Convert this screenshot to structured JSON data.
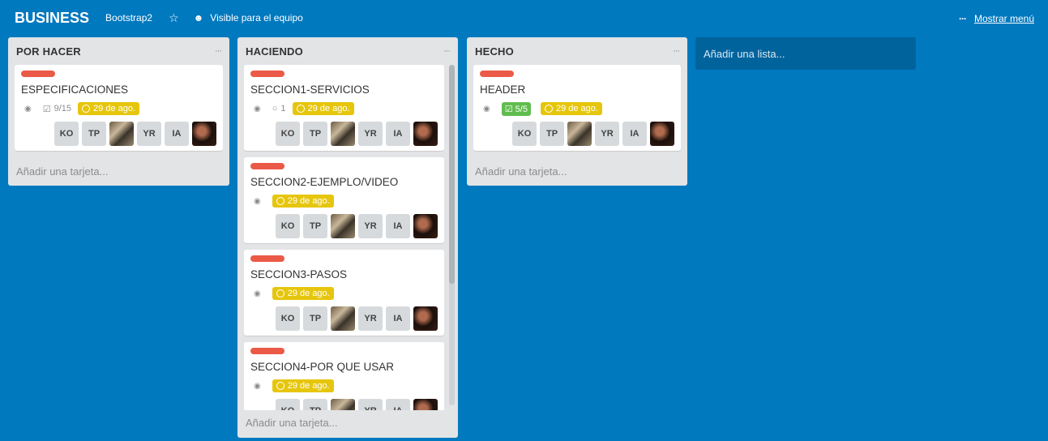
{
  "header": {
    "title": "BUSINESS",
    "org": "Bootstrap2",
    "visibility": "Visible para el equipo",
    "menu_link": "Mostrar menú",
    "star_icon": "star-icon",
    "team_icon": "team-icon"
  },
  "add_list": "Añadir una lista...",
  "members": {
    "ko": "KO",
    "tp": "TP",
    "yr": "YR",
    "ia": "IA"
  },
  "lists": [
    {
      "title": "POR HACER",
      "menu": "···",
      "add_card": "Añadir una tarjeta...",
      "cards": [
        {
          "title": "ESPECIFICACIONES",
          "checklist": "9/15",
          "due": "29 de ago."
        }
      ]
    },
    {
      "title": "HACIENDO",
      "menu": "···",
      "add_card": "Añadir una tarjeta...",
      "cards": [
        {
          "title": "SECCION1-SERVICIOS",
          "comments": "1",
          "due": "29 de ago."
        },
        {
          "title": "SECCION2-EJEMPLO/VIDEO",
          "due": "29 de ago."
        },
        {
          "title": "SECCION3-PASOS",
          "due": "29 de ago."
        },
        {
          "title": "SECCION4-POR QUE USAR",
          "due": "29 de ago."
        }
      ]
    },
    {
      "title": "HECHO",
      "menu": "···",
      "add_card": "Añadir una tarjeta...",
      "cards": [
        {
          "title": "HEADER",
          "checklist": "5/5",
          "due": "29 de ago."
        }
      ]
    }
  ],
  "colors": {
    "board_bg": "#0079bf",
    "label_red": "#eb5a46",
    "due_yellow": "#e6c60d",
    "check_green": "#61bd4f"
  }
}
